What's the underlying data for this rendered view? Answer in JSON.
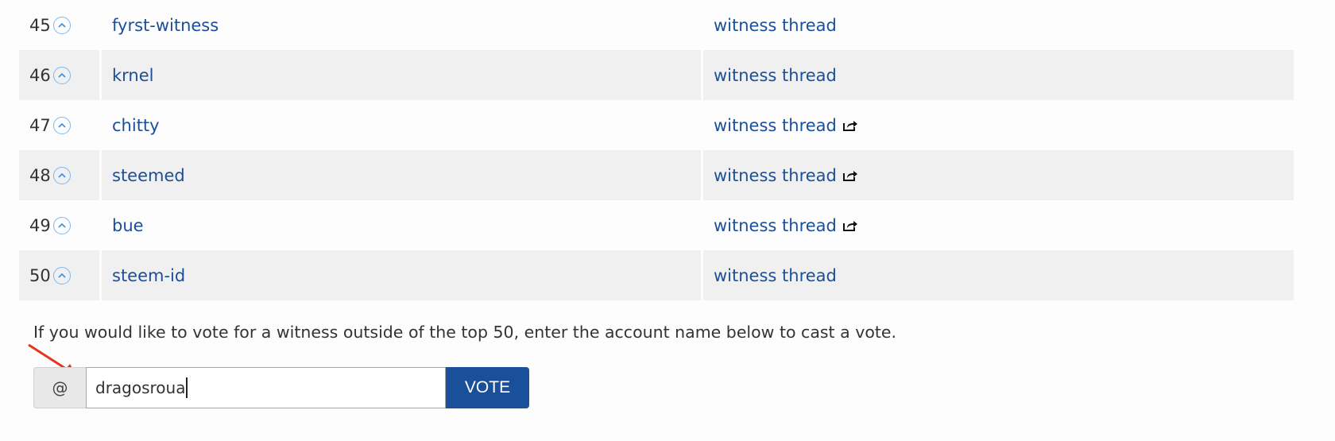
{
  "witnesses": [
    {
      "rank": "45",
      "name": "fyrst-witness",
      "thread": "witness thread",
      "external": false,
      "alt": false
    },
    {
      "rank": "46",
      "name": "krnel",
      "thread": "witness thread",
      "external": false,
      "alt": true
    },
    {
      "rank": "47",
      "name": "chitty",
      "thread": "witness thread",
      "external": true,
      "alt": false
    },
    {
      "rank": "48",
      "name": "steemed",
      "thread": "witness thread",
      "external": true,
      "alt": true
    },
    {
      "rank": "49",
      "name": "bue",
      "thread": "witness thread",
      "external": true,
      "alt": false
    },
    {
      "rank": "50",
      "name": "steem-id",
      "thread": "witness thread",
      "external": false,
      "alt": true
    }
  ],
  "vote_section": {
    "info_text": "If you would like to vote for a witness outside of the top 50, enter the account name below to cast a vote.",
    "prefix": "@",
    "input_value": "dragosroua",
    "button_label": "VOTE"
  },
  "colors": {
    "link": "#1a4f9a",
    "button": "#1a4f9a",
    "annotation_arrow": "#e8341c"
  }
}
